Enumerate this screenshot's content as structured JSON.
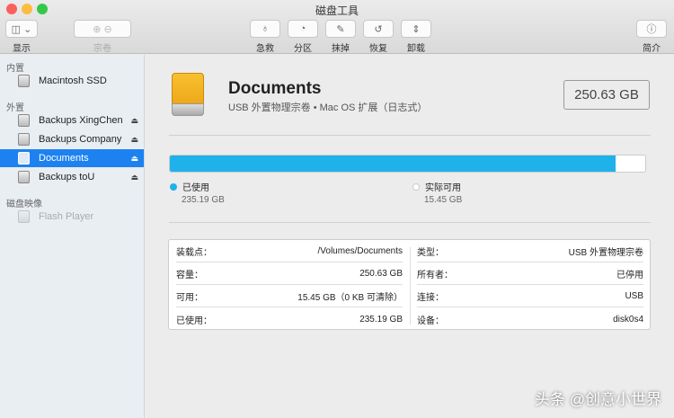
{
  "window": {
    "title": "磁盘工具"
  },
  "toolbar": {
    "display": "显示",
    "volume": "宗卷",
    "first_aid": "急救",
    "partition": "分区",
    "erase": "抹掉",
    "restore": "恢复",
    "unmount": "卸载",
    "info": "简介"
  },
  "sidebar": {
    "internal": "内置",
    "external": "外置",
    "images": "磁盘映像",
    "items": [
      {
        "label": "Macintosh SSD"
      },
      {
        "label": "Backups XingChen"
      },
      {
        "label": "Backups Company"
      },
      {
        "label": "Documents"
      },
      {
        "label": "Backups toU"
      },
      {
        "label": "Flash Player"
      }
    ]
  },
  "volume": {
    "name": "Documents",
    "subtitle": "USB 外置物理宗卷 • Mac OS 扩展（日志式）",
    "size": "250.63 GB",
    "used_fraction": 0.938
  },
  "usage": {
    "used_label": "已使用",
    "used_value": "235.19 GB",
    "free_label": "实际可用",
    "free_value": "15.45 GB",
    "used_color": "#1fb2ea"
  },
  "details": {
    "left": [
      {
        "k": "装载点：",
        "v": "/Volumes/Documents"
      },
      {
        "k": "容量：",
        "v": "250.63 GB"
      },
      {
        "k": "可用：",
        "v": "15.45 GB（0 KB 可清除）"
      },
      {
        "k": "已使用：",
        "v": "235.19 GB"
      }
    ],
    "right": [
      {
        "k": "类型：",
        "v": "USB 外置物理宗卷"
      },
      {
        "k": "所有者：",
        "v": "已停用"
      },
      {
        "k": "连接：",
        "v": "USB"
      },
      {
        "k": "设备：",
        "v": "disk0s4"
      }
    ]
  },
  "watermark": "头条 @创意小世界"
}
